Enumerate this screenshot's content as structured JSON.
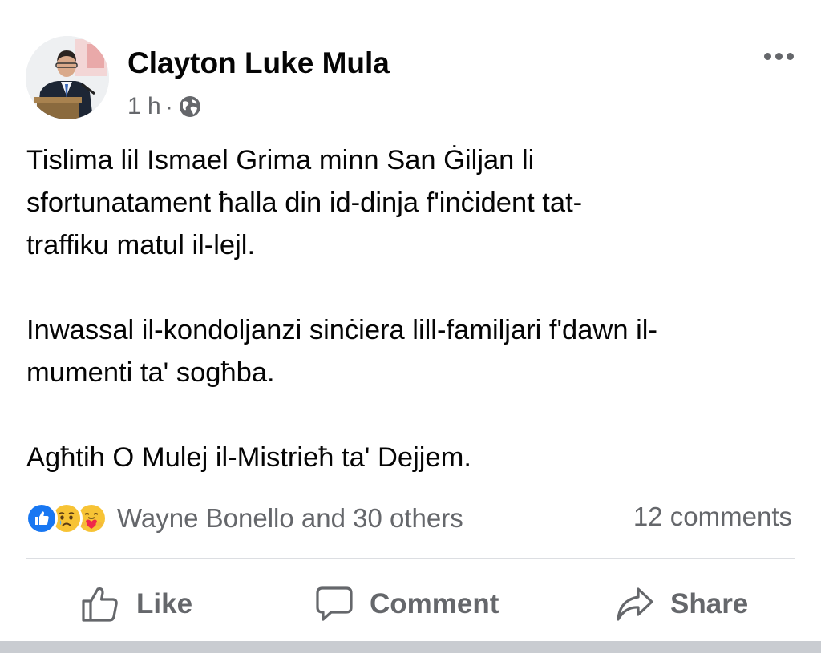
{
  "post": {
    "author": "Clayton Luke Mula",
    "time": "1 h",
    "separator": "·",
    "audience_icon": "globe-icon",
    "more_icon": "more-dots-icon",
    "body": {
      "paragraph1_lines": [
        "Tislima lil Ismael Grima minn San Ġiljan li",
        "sfortunatament ħalla din id-dinja f'inċident tat-",
        "traffiku matul il-lejl."
      ],
      "paragraph2_lines": [
        "Inwassal il-kondoljanzi sinċiera lill-familjari f'dawn il-",
        "mumenti ta' sogħba."
      ],
      "paragraph3_lines": [
        "Agħtih O Mulej il-Mistrieħ ta' Dejjem."
      ]
    },
    "reactions": {
      "icons": [
        "like-reaction-icon",
        "sad-reaction-icon",
        "care-reaction-icon"
      ],
      "summary": "Wayne Bonello and 30 others",
      "comments": "12 comments"
    },
    "actions": {
      "like": "Like",
      "comment": "Comment",
      "share": "Share"
    }
  },
  "colors": {
    "text_primary": "#050505",
    "text_secondary": "#65676b",
    "like_blue": "#1877f2",
    "divider": "#dcdee2"
  }
}
